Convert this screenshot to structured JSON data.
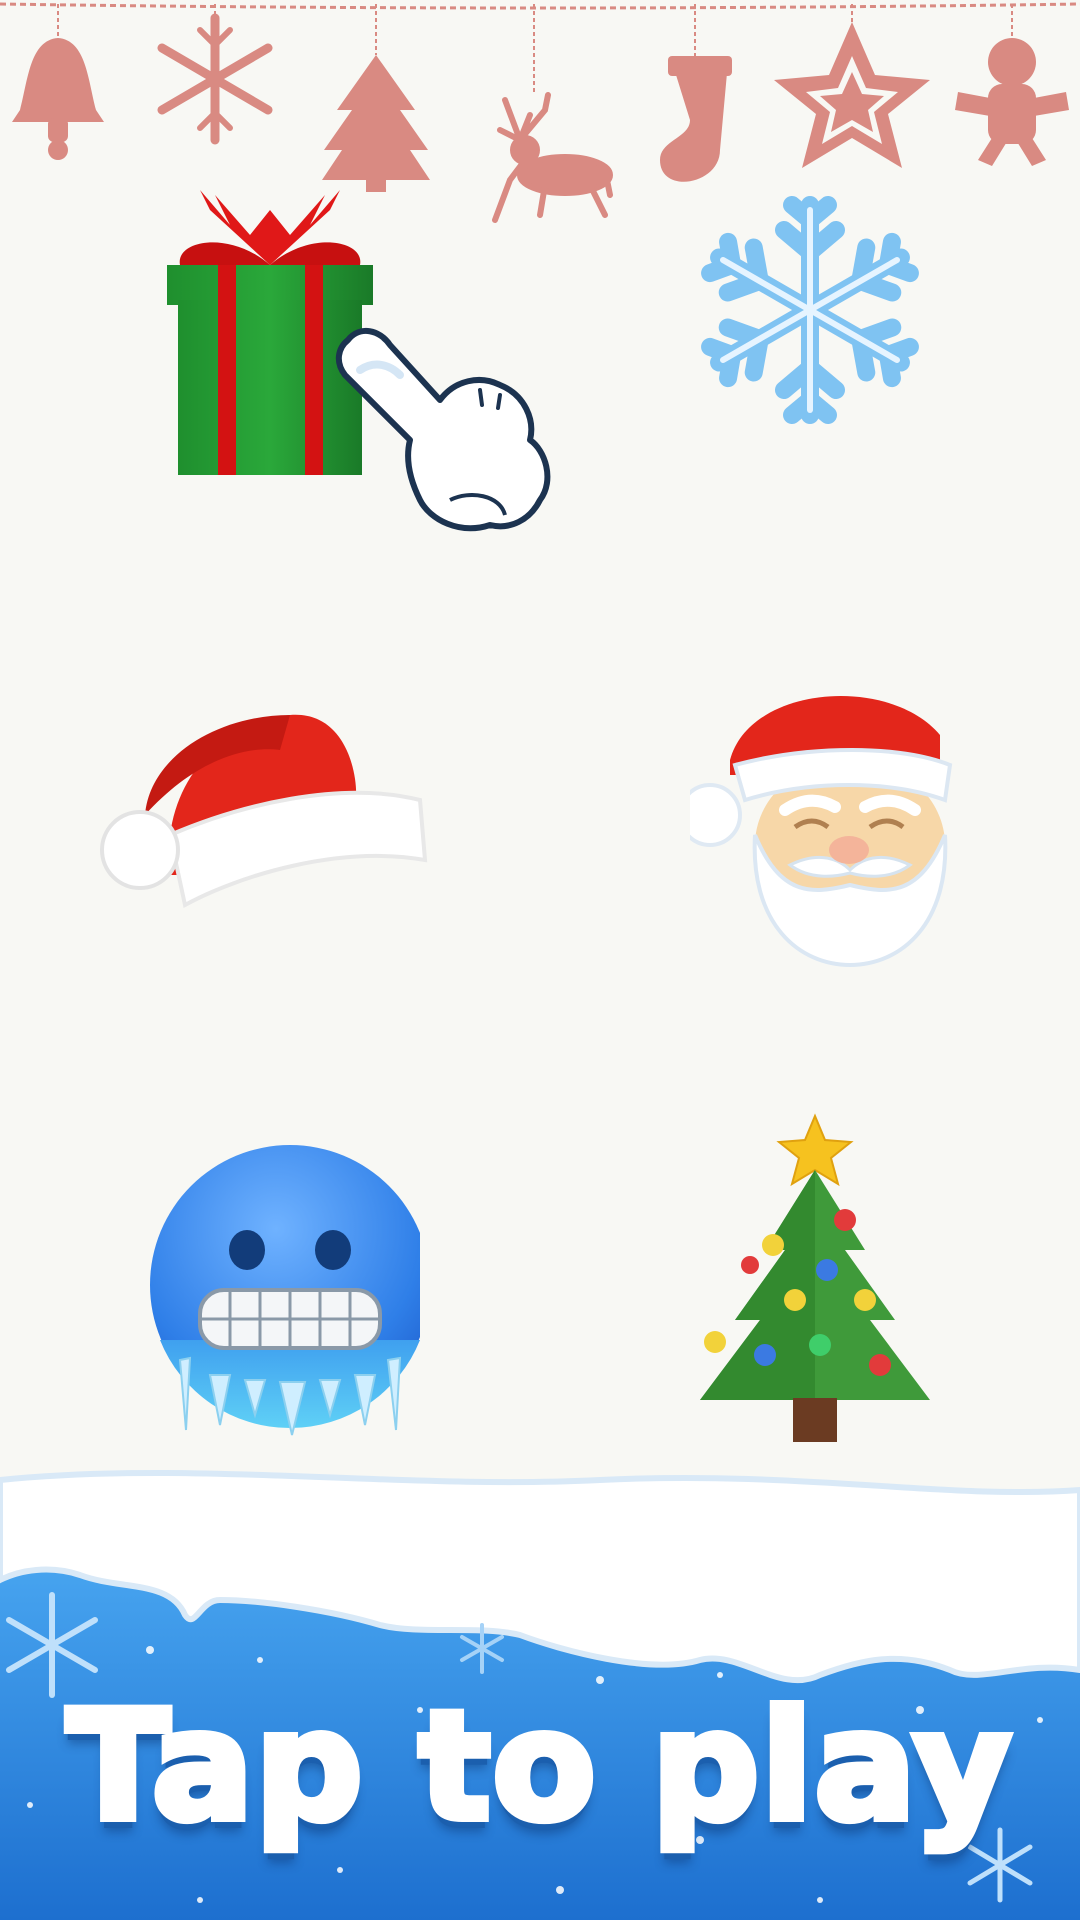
{
  "screen": {
    "background": "#f8f8f4"
  },
  "garland": {
    "color": "#d98a82",
    "ornaments": [
      "bell-icon",
      "snowflake-icon",
      "tree-icon",
      "reindeer-icon",
      "stocking-icon",
      "star-icon",
      "gingerbread-icon"
    ]
  },
  "tiles": [
    {
      "icon": "gift-icon"
    },
    {
      "icon": "snowflake-icon"
    },
    {
      "icon": "santa-hat-icon"
    },
    {
      "icon": "santa-face-icon"
    },
    {
      "icon": "cold-face-icon"
    },
    {
      "icon": "christmas-tree-icon"
    }
  ],
  "hint": {
    "icon": "pointing-hand-icon"
  },
  "footer": {
    "cta_label": "Tap to play",
    "snow_color": "#ffffff",
    "ice_color": "#2d8fe6"
  }
}
